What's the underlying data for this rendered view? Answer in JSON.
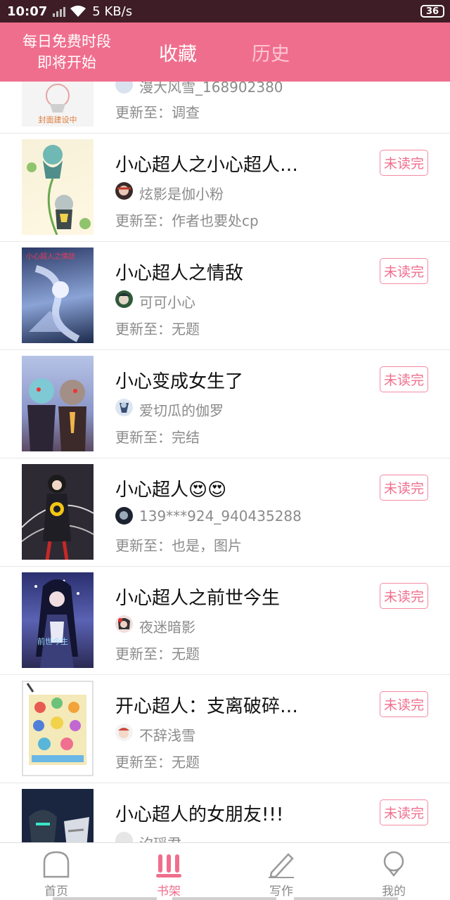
{
  "status": {
    "time": "10:07",
    "speed": "5 KB/s",
    "battery": "36"
  },
  "header": {
    "promo_line1": "每日免费时段",
    "promo_line2": "即将开始",
    "tabs": [
      {
        "label": "收藏"
      },
      {
        "label": "历史"
      }
    ]
  },
  "colors": {
    "brand": "#f06e8d",
    "status_bar": "#3e1d27",
    "badge_border": "#f48aa3"
  },
  "partial_item": {
    "author": "漫大风雪_168902380",
    "update": "更新至：调查",
    "cover_text": "封面建设中"
  },
  "items": [
    {
      "title": "小心超人之小心超人…",
      "author": "炫影是伽小粉",
      "update": "更新至：作者也要处cp",
      "badge": "未读完"
    },
    {
      "title": "小心超人之情敌",
      "author": "可可小心",
      "update": "更新至：无题",
      "badge": "未读完"
    },
    {
      "title": "小心变成女生了",
      "author": "爱切瓜的伽罗",
      "update": "更新至：完结",
      "badge": "未读完"
    },
    {
      "title": "小心超人😍😍",
      "author": "139***924_940435288",
      "update": "更新至：也是，图片",
      "badge": "未读完"
    },
    {
      "title": "小心超人之前世今生",
      "author": "夜迷暗影",
      "update": "更新至：无题",
      "badge": "未读完"
    },
    {
      "title": "开心超人：支离破碎…",
      "author": "不辞浅雪",
      "update": "更新至：无题",
      "badge": "未读完"
    },
    {
      "title": "小心超人的女朋友!!!",
      "author": "汐瑶君",
      "update": "",
      "badge": "未读完"
    }
  ],
  "nav": [
    {
      "label": "首页",
      "icon": "home-icon"
    },
    {
      "label": "书架",
      "icon": "bookshelf-icon"
    },
    {
      "label": "写作",
      "icon": "pen-icon"
    },
    {
      "label": "我的",
      "icon": "profile-icon"
    }
  ]
}
